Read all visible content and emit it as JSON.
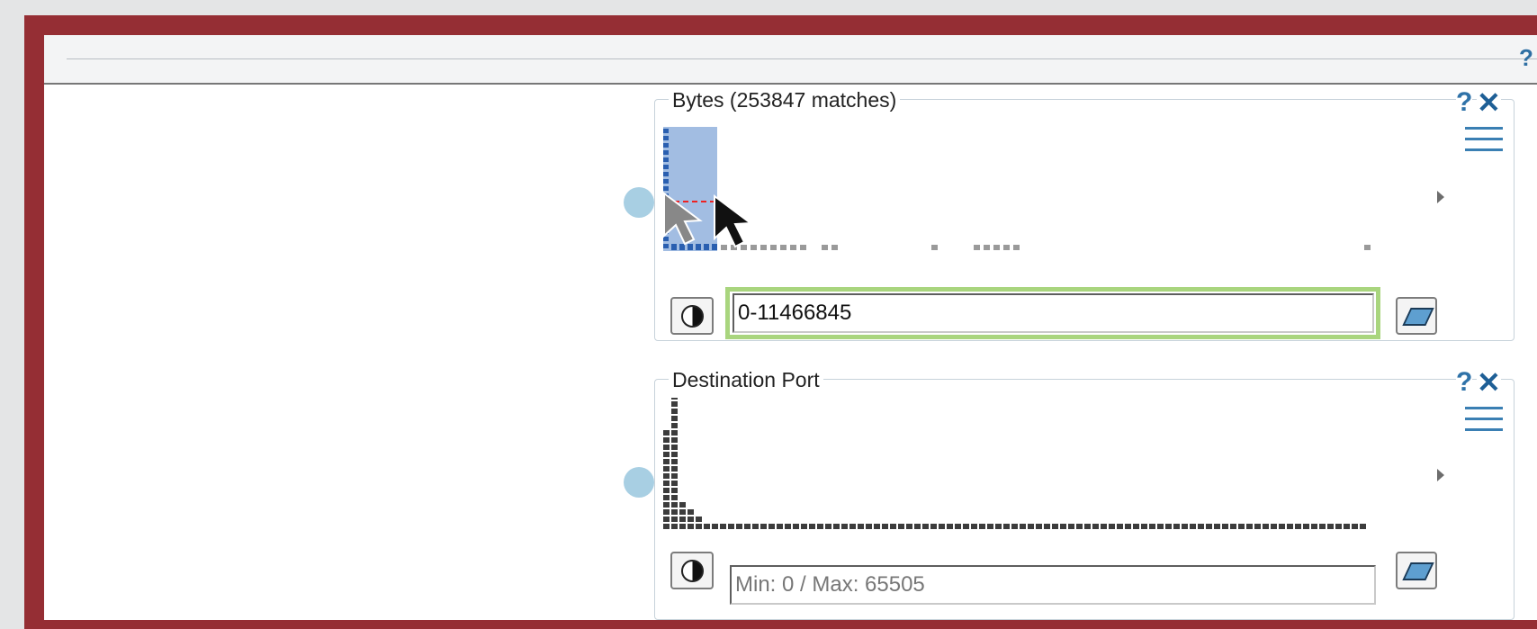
{
  "topbar": {
    "help_label": "?"
  },
  "panels": [
    {
      "title": "Bytes (253847 matches)",
      "help_label": "?",
      "close_label": "✕",
      "input_value": "0-11466845",
      "input_placeholder": "",
      "selection_fraction": 0.07,
      "histogram_fill_color": "#2a5fb0",
      "selection_color": "#a2bde2",
      "highlight_color": "#a9d57e"
    },
    {
      "title": "Destination Port",
      "help_label": "?",
      "close_label": "✕",
      "input_value": "",
      "input_placeholder": "Min: 0 / Max: 65505",
      "histogram_fill_color": "#3c3c3c"
    }
  ],
  "colors": {
    "frame": "#952e34",
    "accent": "#2f72a8",
    "drag_handle": "#a8cfe3"
  },
  "icons": {
    "toggle": "half-circle-icon",
    "clear": "eraser-icon",
    "menu": "hamburger-icon",
    "expand": "triangle-right-icon",
    "help": "question-icon",
    "close": "close-icon",
    "cursor": "cursor-icon"
  }
}
